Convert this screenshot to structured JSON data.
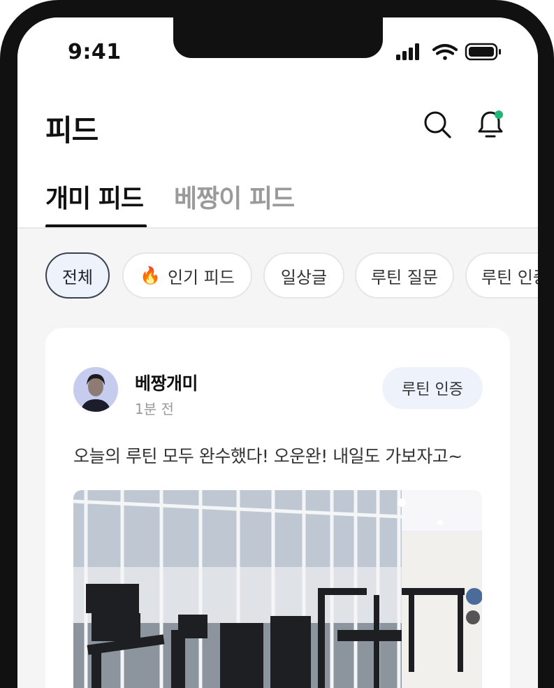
{
  "status_bar": {
    "time": "9:41",
    "signal_icon": "cellular-signal-icon",
    "wifi_icon": "wifi-icon",
    "battery_icon": "battery-icon"
  },
  "header": {
    "title": "피드",
    "search_icon": "search-icon",
    "notification_icon": "bell-icon",
    "notification_dot_color": "#22b573"
  },
  "tabs": [
    {
      "label": "개미 피드",
      "active": true
    },
    {
      "label": "베짱이 피드",
      "active": false
    }
  ],
  "filters": [
    {
      "label": "전체",
      "selected": true
    },
    {
      "label": "인기 피드",
      "icon": "🔥",
      "selected": false
    },
    {
      "label": "일상글",
      "selected": false
    },
    {
      "label": "루틴 질문",
      "selected": false
    },
    {
      "label": "루틴 인증",
      "selected": false
    }
  ],
  "post": {
    "author": "베짱개미",
    "time": "1분 전",
    "category_badge": "루틴 인증",
    "content": "오늘의 루틴 모두 완수했다! 오운완! 내일도 가보자고~",
    "image_subject": "gym-photo"
  },
  "colors": {
    "accent_selected_bg": "#eef3fb",
    "accent_selected_border": "#3a4152",
    "text_primary": "#111111",
    "text_secondary": "#9a9a9a"
  }
}
